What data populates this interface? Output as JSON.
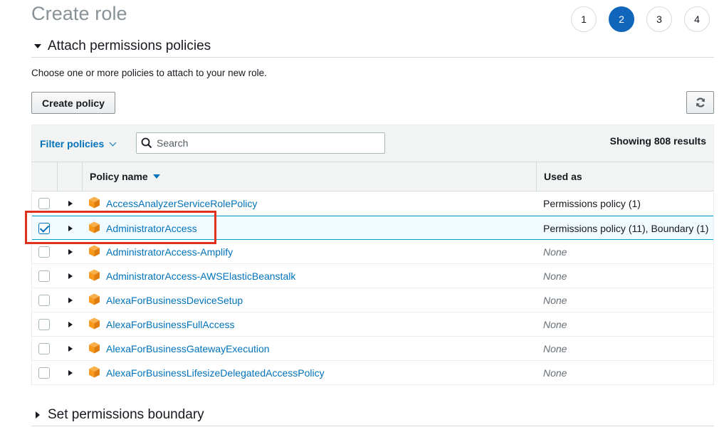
{
  "page": {
    "title": "Create role"
  },
  "steps": [
    "1",
    "2",
    "3",
    "4"
  ],
  "active_step": 2,
  "attach_section": {
    "title": "Attach permissions policies",
    "description": "Choose one or more policies to attach to your new role.",
    "create_policy_label": "Create policy",
    "refresh_icon": "refresh-icon"
  },
  "filter": {
    "label": "Filter policies",
    "search_placeholder": "Search",
    "results_text": "Showing 808 results"
  },
  "table": {
    "columns": {
      "name": "Policy name",
      "used_as": "Used as"
    },
    "rows": [
      {
        "name": "AccessAnalyzerServiceRolePolicy",
        "used_as": "Permissions policy (1)",
        "checked": false
      },
      {
        "name": "AdministratorAccess",
        "used_as": "Permissions policy (11), Boundary (1)",
        "checked": true
      },
      {
        "name": "AdministratorAccess-Amplify",
        "used_as": "None",
        "checked": false
      },
      {
        "name": "AdministratorAccess-AWSElasticBeanstalk",
        "used_as": "None",
        "checked": false
      },
      {
        "name": "AlexaForBusinessDeviceSetup",
        "used_as": "None",
        "checked": false
      },
      {
        "name": "AlexaForBusinessFullAccess",
        "used_as": "None",
        "checked": false
      },
      {
        "name": "AlexaForBusinessGatewayExecution",
        "used_as": "None",
        "checked": false
      },
      {
        "name": "AlexaForBusinessLifesizeDelegatedAccessPolicy",
        "used_as": "None",
        "checked": false
      }
    ]
  },
  "boundary_section": {
    "title": "Set permissions boundary"
  },
  "colors": {
    "accent": "#1166bb",
    "link": "#0073bb",
    "highlight": "#e0301e",
    "policy_icon": "#f7991c"
  }
}
